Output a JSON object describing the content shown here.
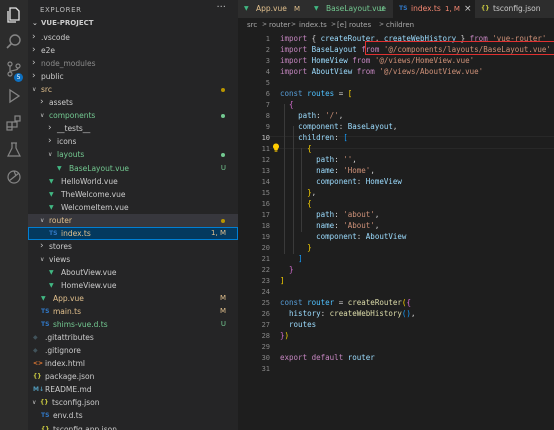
{
  "sidebar": {
    "title": "EXPLORER",
    "more": "···",
    "project": "VUE-PROJECT",
    "tree": [
      {
        "label": ".vscode",
        "kind": "folder",
        "depth": 1,
        "open": false,
        "color": "#cccccc"
      },
      {
        "label": "e2e",
        "kind": "folder",
        "depth": 1,
        "open": false,
        "color": "#cccccc"
      },
      {
        "label": "node_modules",
        "kind": "folder",
        "depth": 1,
        "open": false,
        "color": "#8c8c8c"
      },
      {
        "label": "public",
        "kind": "folder",
        "depth": 1,
        "open": false,
        "color": "#cccccc"
      },
      {
        "label": "src",
        "kind": "folder",
        "depth": 1,
        "open": true,
        "color": "#e2c08d",
        "dot": "#b89500"
      },
      {
        "label": "assets",
        "kind": "folder",
        "depth": 2,
        "open": false,
        "color": "#cccccc"
      },
      {
        "label": "components",
        "kind": "folder",
        "depth": 2,
        "open": true,
        "color": "#73c991",
        "dot": "#73c991"
      },
      {
        "label": "__tests__",
        "kind": "folder",
        "depth": 3,
        "open": false,
        "color": "#cccccc"
      },
      {
        "label": "icons",
        "kind": "folder",
        "depth": 3,
        "open": false,
        "color": "#cccccc"
      },
      {
        "label": "layouts",
        "kind": "folder",
        "depth": 3,
        "open": true,
        "color": "#73c991",
        "dot": "#73c991"
      },
      {
        "label": "BaseLayout.vue",
        "kind": "vue",
        "depth": 4,
        "color": "#73c991",
        "badge": "U"
      },
      {
        "label": "HelloWorld.vue",
        "kind": "vue",
        "depth": 3,
        "color": "#cccccc"
      },
      {
        "label": "TheWelcome.vue",
        "kind": "vue",
        "depth": 3,
        "color": "#cccccc"
      },
      {
        "label": "WelcomeItem.vue",
        "kind": "vue",
        "depth": 3,
        "color": "#cccccc"
      },
      {
        "label": "router",
        "kind": "folder",
        "depth": 2,
        "open": true,
        "color": "#e2c08d",
        "dot": "#b89500",
        "sel": true
      },
      {
        "label": "index.ts",
        "kind": "ts",
        "depth": 3,
        "color": "#e2c08d",
        "badge": "1, M",
        "badge_color": "#e2c08d",
        "active": true
      },
      {
        "label": "stores",
        "kind": "folder",
        "depth": 2,
        "open": false,
        "color": "#cccccc"
      },
      {
        "label": "views",
        "kind": "folder",
        "depth": 2,
        "open": true,
        "color": "#cccccc"
      },
      {
        "label": "AboutView.vue",
        "kind": "vue",
        "depth": 3,
        "color": "#cccccc"
      },
      {
        "label": "HomeView.vue",
        "kind": "vue",
        "depth": 3,
        "color": "#cccccc"
      },
      {
        "label": "App.vue",
        "kind": "vue",
        "depth": 2,
        "color": "#e2c08d",
        "badge": "M",
        "badge_color": "#e2c08d"
      },
      {
        "label": "main.ts",
        "kind": "ts",
        "depth": 2,
        "color": "#e2c08d",
        "badge": "M",
        "badge_color": "#e2c08d"
      },
      {
        "label": "shims-vue.d.ts",
        "kind": "ts",
        "depth": 2,
        "color": "#73c991",
        "badge": "U",
        "badge_color": "#73c991"
      },
      {
        "label": ".gitattributes",
        "kind": "git",
        "depth": 1,
        "color": "#cccccc"
      },
      {
        "label": ".gitignore",
        "kind": "git",
        "depth": 1,
        "color": "#cccccc"
      },
      {
        "label": "index.html",
        "kind": "html",
        "depth": 1,
        "color": "#cccccc"
      },
      {
        "label": "package.json",
        "kind": "json",
        "depth": 1,
        "color": "#cccccc"
      },
      {
        "label": "README.md",
        "kind": "md",
        "depth": 1,
        "color": "#cccccc"
      },
      {
        "label": "tsconfig.json",
        "kind": "json",
        "depth": 1,
        "open": true,
        "color": "#cccccc",
        "chev": true
      },
      {
        "label": "env.d.ts",
        "kind": "ts",
        "depth": 2,
        "color": "#cccccc"
      },
      {
        "label": "tsconfig.app.json",
        "kind": "json",
        "depth": 2,
        "color": "#cccccc"
      }
    ]
  },
  "tabs": [
    {
      "label": "App.vue",
      "icon": "vue",
      "status": "M",
      "color": "#e2c08d"
    },
    {
      "label": "BaseLayout.vue",
      "icon": "vue",
      "status": "U",
      "color": "#73c991"
    },
    {
      "label": "index.ts",
      "icon": "ts",
      "status": "1, M",
      "color": "#f48771",
      "active": true
    },
    {
      "label": "tsconfig.json",
      "icon": "json",
      "status": "",
      "color": "#cccccc"
    }
  ],
  "breadcrumb": {
    "parts": [
      "src",
      ">",
      "router",
      ">",
      "index.ts",
      ">",
      "[e] routes",
      ">",
      "children"
    ]
  },
  "editor": {
    "current_line": 10,
    "lines": [
      [
        [
          "k",
          "import "
        ],
        [
          "p",
          "{ "
        ],
        [
          "v",
          "createRouter"
        ],
        [
          "p",
          ", "
        ],
        [
          "v",
          "createWebHistory"
        ],
        [
          "p",
          " } "
        ],
        [
          "k",
          "from "
        ],
        [
          "s",
          "'vue-router'"
        ]
      ],
      [
        [
          "k",
          "import "
        ],
        [
          "v",
          "BaseLayout "
        ],
        [
          "k",
          "from "
        ],
        [
          "s",
          "'@/components/layouts/BaseLayout.vue'"
        ]
      ],
      [
        [
          "k",
          "import "
        ],
        [
          "v",
          "HomeView "
        ],
        [
          "k",
          "from "
        ],
        [
          "s",
          "'@/views/HomeView.vue'"
        ]
      ],
      [
        [
          "k",
          "import "
        ],
        [
          "v",
          "AboutView "
        ],
        [
          "k",
          "from "
        ],
        [
          "s",
          "'@/views/AboutView.vue'"
        ]
      ],
      [],
      [
        [
          "kb",
          "const "
        ],
        [
          "c",
          "routes "
        ],
        [
          "p",
          "= "
        ],
        [
          "b1",
          "["
        ]
      ],
      [
        [
          "p",
          "  "
        ],
        [
          "b2",
          "{"
        ]
      ],
      [
        [
          "p",
          "    "
        ],
        [
          "v",
          "path"
        ],
        [
          "p",
          ": "
        ],
        [
          "s",
          "'/'"
        ],
        [
          "p",
          ","
        ]
      ],
      [
        [
          "p",
          "    "
        ],
        [
          "v",
          "component"
        ],
        [
          "p",
          ": "
        ],
        [
          "v",
          "BaseLayout"
        ],
        [
          "p",
          ","
        ]
      ],
      [
        [
          "p",
          "    "
        ],
        [
          "v",
          "children"
        ],
        [
          "p",
          ": "
        ],
        [
          "b3",
          "["
        ]
      ],
      [
        [
          "p",
          "      "
        ],
        [
          "b1",
          "{"
        ]
      ],
      [
        [
          "p",
          "        "
        ],
        [
          "v",
          "path"
        ],
        [
          "p",
          ": "
        ],
        [
          "s",
          "''"
        ],
        [
          "p",
          ","
        ]
      ],
      [
        [
          "p",
          "        "
        ],
        [
          "v",
          "name"
        ],
        [
          "p",
          ": "
        ],
        [
          "s",
          "'Home'"
        ],
        [
          "p",
          ","
        ]
      ],
      [
        [
          "p",
          "        "
        ],
        [
          "v",
          "component"
        ],
        [
          "p",
          ": "
        ],
        [
          "v",
          "HomeView"
        ]
      ],
      [
        [
          "p",
          "      "
        ],
        [
          "b1",
          "}"
        ],
        [
          "p",
          ","
        ]
      ],
      [
        [
          "p",
          "      "
        ],
        [
          "b1",
          "{"
        ]
      ],
      [
        [
          "p",
          "        "
        ],
        [
          "v",
          "path"
        ],
        [
          "p",
          ": "
        ],
        [
          "s",
          "'about'"
        ],
        [
          "p",
          ","
        ]
      ],
      [
        [
          "p",
          "        "
        ],
        [
          "v",
          "name"
        ],
        [
          "p",
          ": "
        ],
        [
          "s",
          "'About'"
        ],
        [
          "p",
          ","
        ]
      ],
      [
        [
          "p",
          "        "
        ],
        [
          "v",
          "component"
        ],
        [
          "p",
          ": "
        ],
        [
          "v",
          "AboutView"
        ]
      ],
      [
        [
          "p",
          "      "
        ],
        [
          "b1",
          "}"
        ]
      ],
      [
        [
          "p",
          "    "
        ],
        [
          "b3",
          "]"
        ]
      ],
      [
        [
          "p",
          "  "
        ],
        [
          "b2",
          "}"
        ]
      ],
      [
        [
          "b1",
          "]"
        ]
      ],
      [],
      [
        [
          "kb",
          "const "
        ],
        [
          "c",
          "router "
        ],
        [
          "p",
          "= "
        ],
        [
          "f",
          "createRouter"
        ],
        [
          "b1",
          "("
        ],
        [
          "b2",
          "{"
        ]
      ],
      [
        [
          "p",
          "  "
        ],
        [
          "v",
          "history"
        ],
        [
          "p",
          ": "
        ],
        [
          "f",
          "createWebHistory"
        ],
        [
          "b3",
          "()"
        ],
        [
          "p",
          ","
        ]
      ],
      [
        [
          "p",
          "  "
        ],
        [
          "v",
          "routes"
        ]
      ],
      [
        [
          "b2",
          "}"
        ],
        [
          "b1",
          ")"
        ]
      ],
      [],
      [
        [
          "k",
          "export "
        ],
        [
          "k",
          "default "
        ],
        [
          "v",
          "router"
        ]
      ],
      []
    ]
  }
}
